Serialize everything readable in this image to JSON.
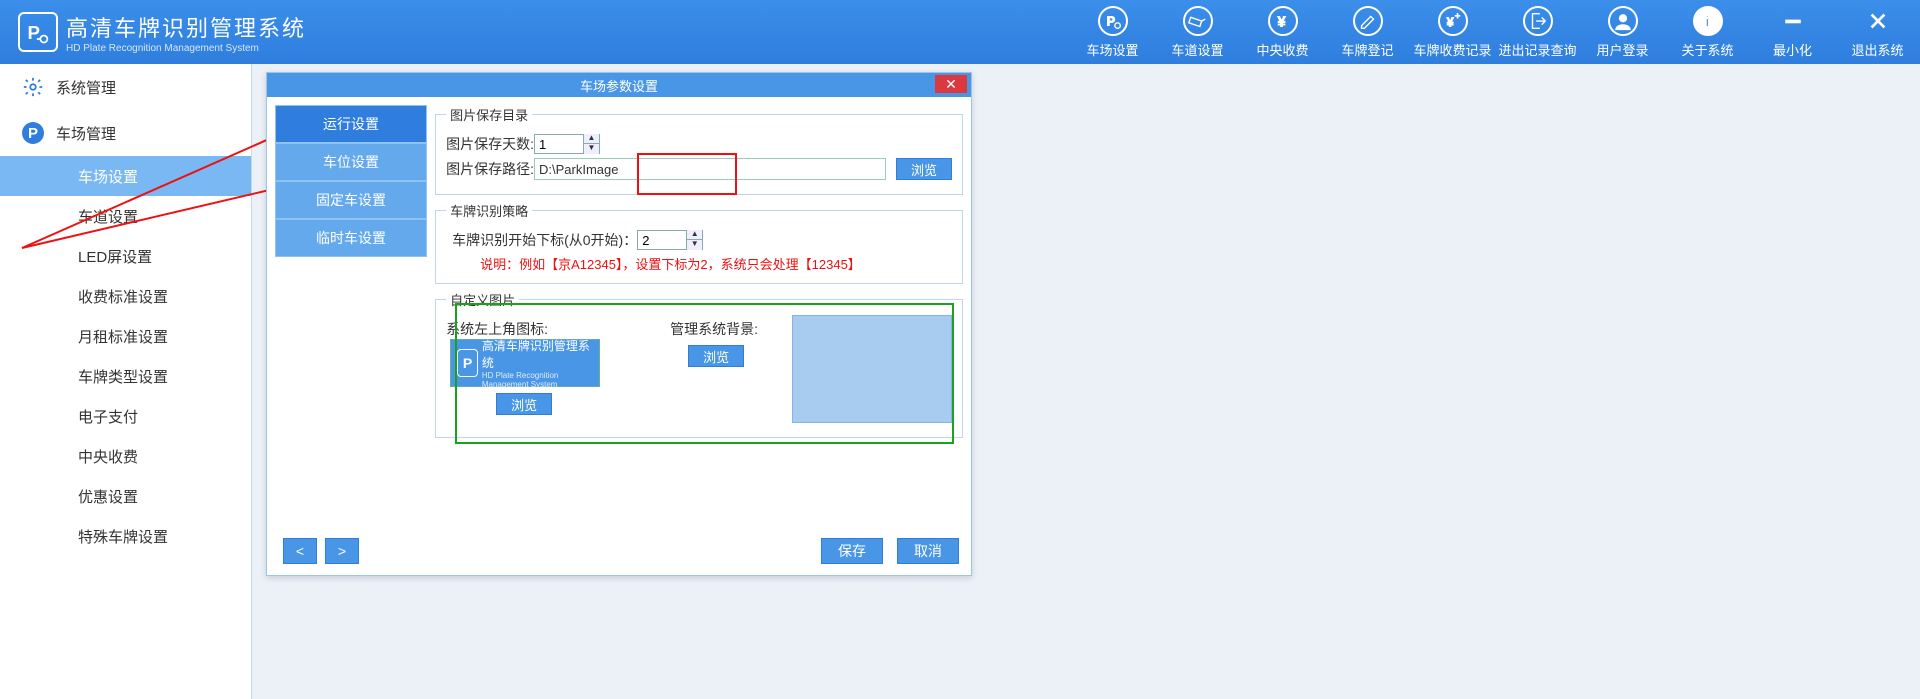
{
  "app": {
    "title": "高清车牌识别管理系统",
    "subtitle": "HD Plate Recognition Management System"
  },
  "toolbar": {
    "items": [
      {
        "label": "车场设置"
      },
      {
        "label": "车道设置"
      },
      {
        "label": "中央收费"
      },
      {
        "label": "车牌登记"
      },
      {
        "label": "车牌收费记录"
      },
      {
        "label": "进出记录查询"
      },
      {
        "label": "用户登录"
      },
      {
        "label": "关于系统"
      },
      {
        "label": "最小化"
      },
      {
        "label": "退出系统"
      }
    ]
  },
  "sidebar": {
    "sys_label": "系统管理",
    "park_label": "车场管理",
    "items": [
      "车场设置",
      "车道设置",
      "LED屏设置",
      "收费标准设置",
      "月租标准设置",
      "车牌类型设置",
      "电子支付",
      "中央收费",
      "优惠设置",
      "特殊车牌设置"
    ],
    "active_index": 0
  },
  "dialog": {
    "title": "车场参数设置",
    "tabs": [
      "运行设置",
      "车位设置",
      "固定车设置",
      "临时车设置"
    ],
    "active_tab": 0,
    "group_save": {
      "legend": "图片保存目录",
      "days_label": "图片保存天数:",
      "days_value": "1",
      "path_label": "图片保存路径:",
      "path_value": "D:\\ParkImage",
      "browse": "浏览"
    },
    "group_rec": {
      "legend": "车牌识别策略",
      "idx_label": "车牌识别开始下标(从0开始)：",
      "idx_value": "2",
      "desc": "说明：例如【京A12345】，设置下标为2，系统只会处理【12345】"
    },
    "group_custom": {
      "legend": "自定义图片",
      "left_label": "系统左上角图标:",
      "right_label": "管理系统背景:",
      "browse": "浏览",
      "preview_title": "高清车牌识别管理系统",
      "preview_sub": "HD Plate Recognition Management System"
    },
    "footer": {
      "prev": "<",
      "next": ">",
      "save": "保存",
      "cancel": "取消"
    }
  }
}
